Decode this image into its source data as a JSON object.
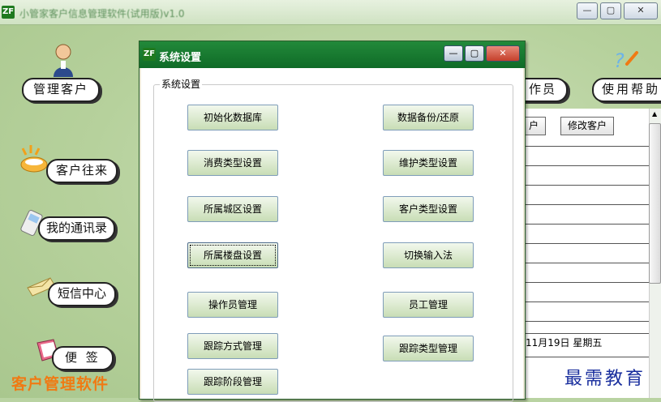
{
  "main_window": {
    "title": "小管家客户信息管理软件(试用版)v1.0",
    "app_icon_text": "ZF",
    "controls": [
      "—",
      "▢",
      "✕"
    ]
  },
  "nav": {
    "manage_clients": "管理客户",
    "client_dealings": "客户往来",
    "my_contacts": "我的通讯录",
    "sms_center": "短信中心",
    "notes": "便 签",
    "operators_partial": "作员",
    "help": "使用帮助"
  },
  "brand_text": "客户管理软件",
  "watermark": "最需教育",
  "list_panel": {
    "add_button_partial": "户",
    "edit_button": "修改客户",
    "date_text": "11月19日 星期五"
  },
  "dialog": {
    "title": "系统设置",
    "group_label": "系统设置",
    "buttons": {
      "init_db": "初始化数据库",
      "backup_restore": "数据备份/还原",
      "consumption_type": "消费类型设置",
      "maintenance_type": "维护类型设置",
      "district": "所属城区设置",
      "client_type": "客户类型设置",
      "building": "所属楼盘设置",
      "switch_ime": "切换输入法",
      "operator_mgmt": "操作员管理",
      "staff_mgmt": "员工管理",
      "tracking_method": "跟踪方式管理",
      "tracking_type": "跟踪类型管理",
      "tracking_stage": "跟踪阶段管理"
    }
  },
  "colors": {
    "brand": "#f07a13",
    "dialog_title": "#0f6b27",
    "watermark": "#1a2f9e"
  }
}
